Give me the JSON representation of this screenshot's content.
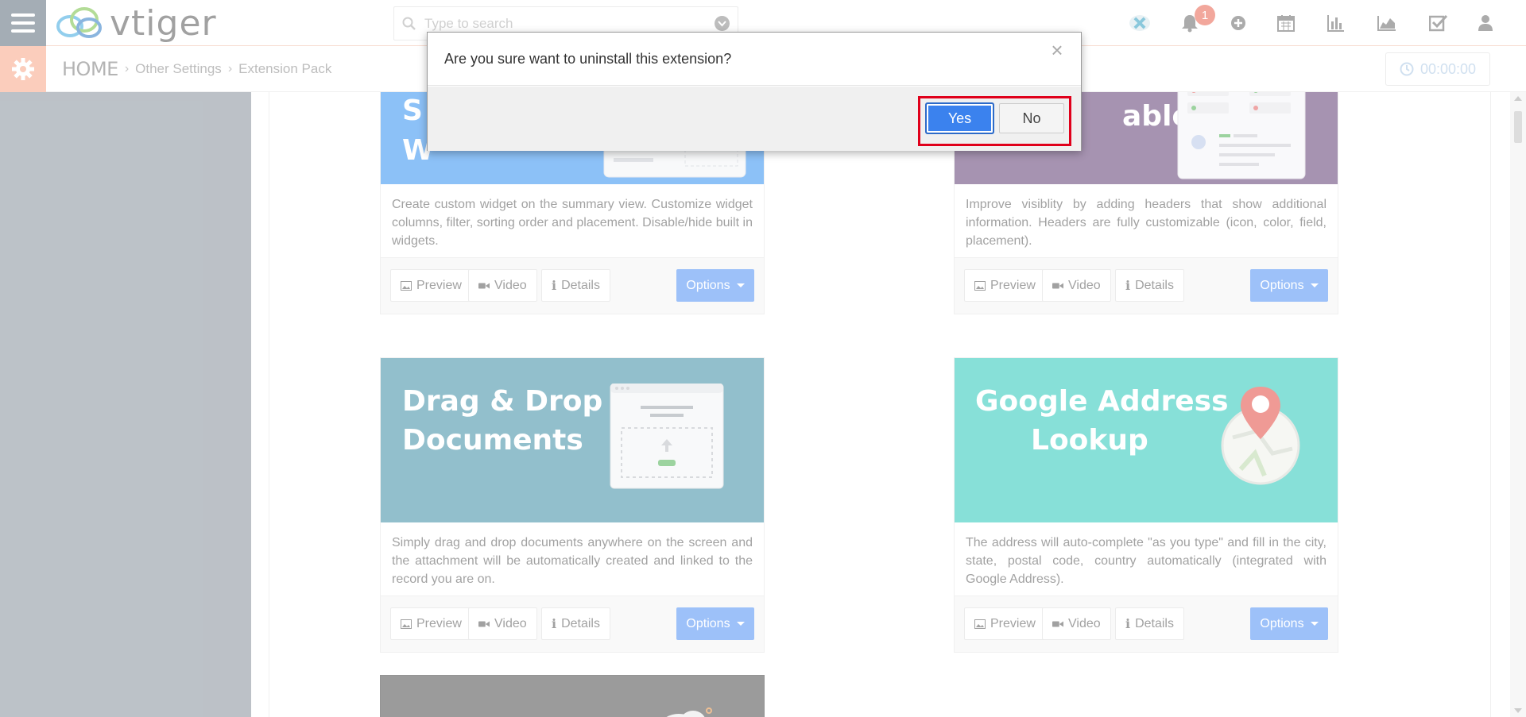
{
  "header": {
    "logo_text": "vtiger",
    "search_placeholder": "Type to search",
    "notification_count": "1"
  },
  "subheader": {
    "breadcrumb": [
      "HOME",
      "Other Settings",
      "Extension Pack"
    ],
    "timer": "00:00:00"
  },
  "cards": [
    {
      "title_line1": "S",
      "title_line2": "W",
      "banner_color": "#2f8ff0",
      "description": "Create custom widget on the summary view. Customize widget columns, filter, sorting order and placement. Disable/hide built in widgets.",
      "preview": "Preview",
      "video": "Video",
      "details": "Details",
      "options": "Options"
    },
    {
      "title_line1": "able",
      "title_line2": "",
      "banner_color": "#5e3b72",
      "description": "Improve visiblity by adding headers that show additional information. Headers are fully customizable (icon, color, field, placement).",
      "preview": "Preview",
      "video": "Video",
      "details": "Details",
      "options": "Options"
    },
    {
      "title_line1": "Drag & Drop",
      "title_line2": "Documents",
      "banner_color": "#3a8ba2",
      "description": "Simply drag and drop documents anywhere on the screen and the attachment will be automatically created and linked to the record you are on.",
      "preview": "Preview",
      "video": "Video",
      "details": "Details",
      "options": "Options"
    },
    {
      "title_line1": "Google Address",
      "title_line2": "Lookup",
      "banner_color": "#26c6b8",
      "description": "The address will auto-complete \"as you type\" and fill in the city, state, postal code, country automatically (integrated with Google Address).",
      "preview": "Preview",
      "video": "Video",
      "details": "Details",
      "options": "Options"
    }
  ],
  "modal": {
    "message": "Are you sure want to uninstall this extension?",
    "close": "×",
    "yes": "Yes",
    "no": "No"
  },
  "colors": {
    "accent": "#3b82ee",
    "highlight": "#e0001b",
    "notification": "#e8604c",
    "settings": "#f7a586"
  }
}
